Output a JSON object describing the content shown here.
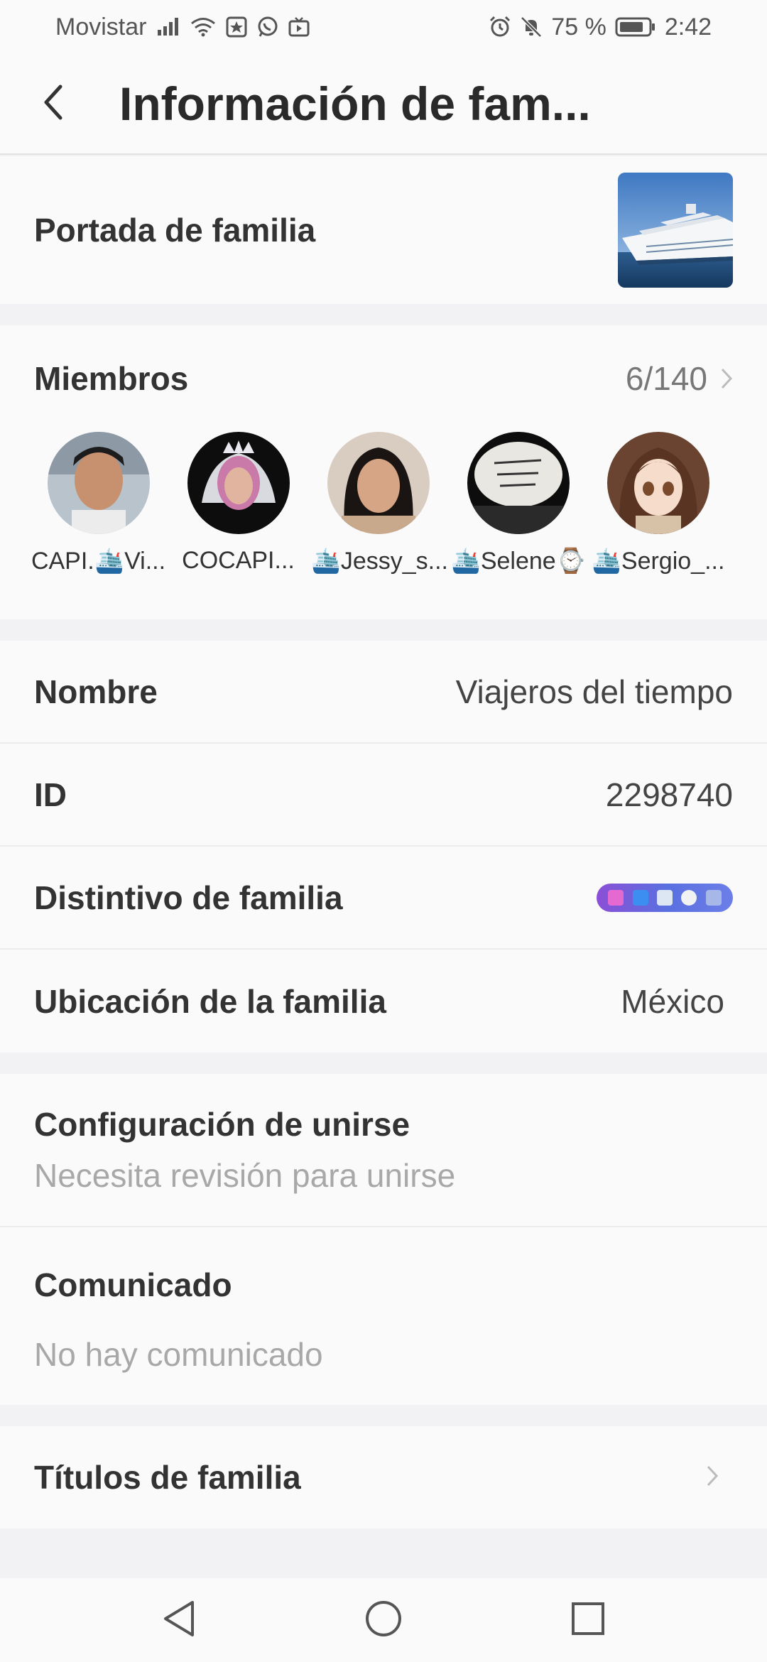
{
  "status_bar": {
    "carrier": "Movistar",
    "battery": "75 %",
    "time": "2:42",
    "icons": [
      "signal-icon",
      "wifi-icon",
      "app-notification-icon",
      "whatsapp-icon",
      "tv-icon",
      "alarm-icon",
      "mute-icon",
      "battery-icon"
    ]
  },
  "header": {
    "title": "Información de fam..."
  },
  "cover": {
    "label": "Portada de familia",
    "image": "cruise-ship-photo"
  },
  "members": {
    "label": "Miembros",
    "count": "6/140",
    "list": [
      {
        "name": "CAPI.🛳️Vi..."
      },
      {
        "name": "COCAPI..."
      },
      {
        "name": "🛳️Jessy_s..."
      },
      {
        "name": "🛳️Selene⌚"
      },
      {
        "name": "🛳️Sergio_..."
      }
    ]
  },
  "info": {
    "name_label": "Nombre",
    "name_value": "Viajeros del tiempo",
    "id_label": "ID",
    "id_value": "2298740",
    "badge_label": "Distintivo de familia",
    "location_label": "Ubicación de la familia",
    "location_value": "México"
  },
  "join": {
    "label": "Configuración de unirse",
    "value": "Necesita revisión para unirse"
  },
  "notice": {
    "label": "Comunicado",
    "value": "No hay comunicado"
  },
  "titles": {
    "label": "Títulos de familia"
  },
  "colors": {
    "background": "#f2f2f5",
    "surface": "#fafafa",
    "text": "#2b2b2b",
    "muted": "#a8a8a8",
    "badge_start": "#8b4fd6",
    "badge_end": "#6c7fe8"
  }
}
